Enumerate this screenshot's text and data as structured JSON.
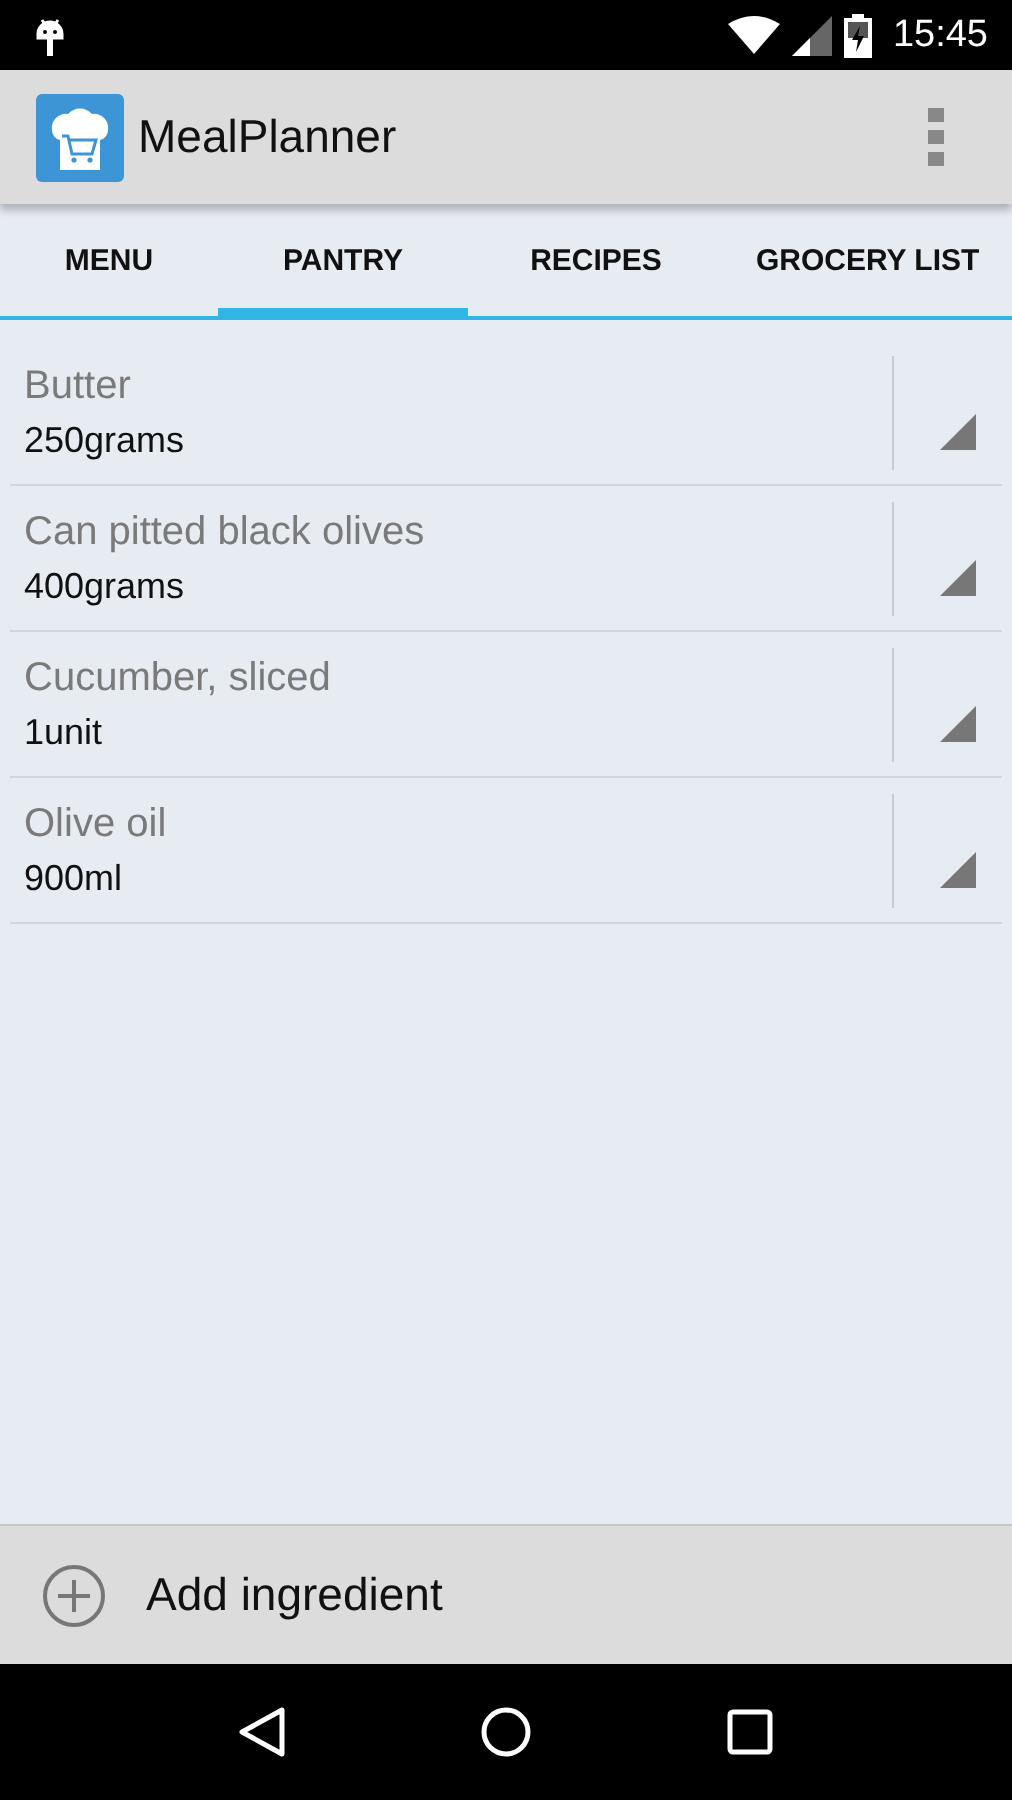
{
  "status_bar": {
    "time": "15:45"
  },
  "app_bar": {
    "title": "MealPlanner"
  },
  "tabs": [
    {
      "label": "MENU",
      "selected": false
    },
    {
      "label": "PANTRY",
      "selected": true
    },
    {
      "label": "RECIPES",
      "selected": false
    },
    {
      "label": "GROCERY LIST",
      "selected": false
    }
  ],
  "items": [
    {
      "name": "Butter",
      "quantity": "250grams"
    },
    {
      "name": "Can pitted black olives",
      "quantity": "400grams"
    },
    {
      "name": "Cucumber, sliced",
      "quantity": "1unit"
    },
    {
      "name": "Olive oil",
      "quantity": "900ml"
    }
  ],
  "add_button": {
    "label": "Add ingredient"
  }
}
